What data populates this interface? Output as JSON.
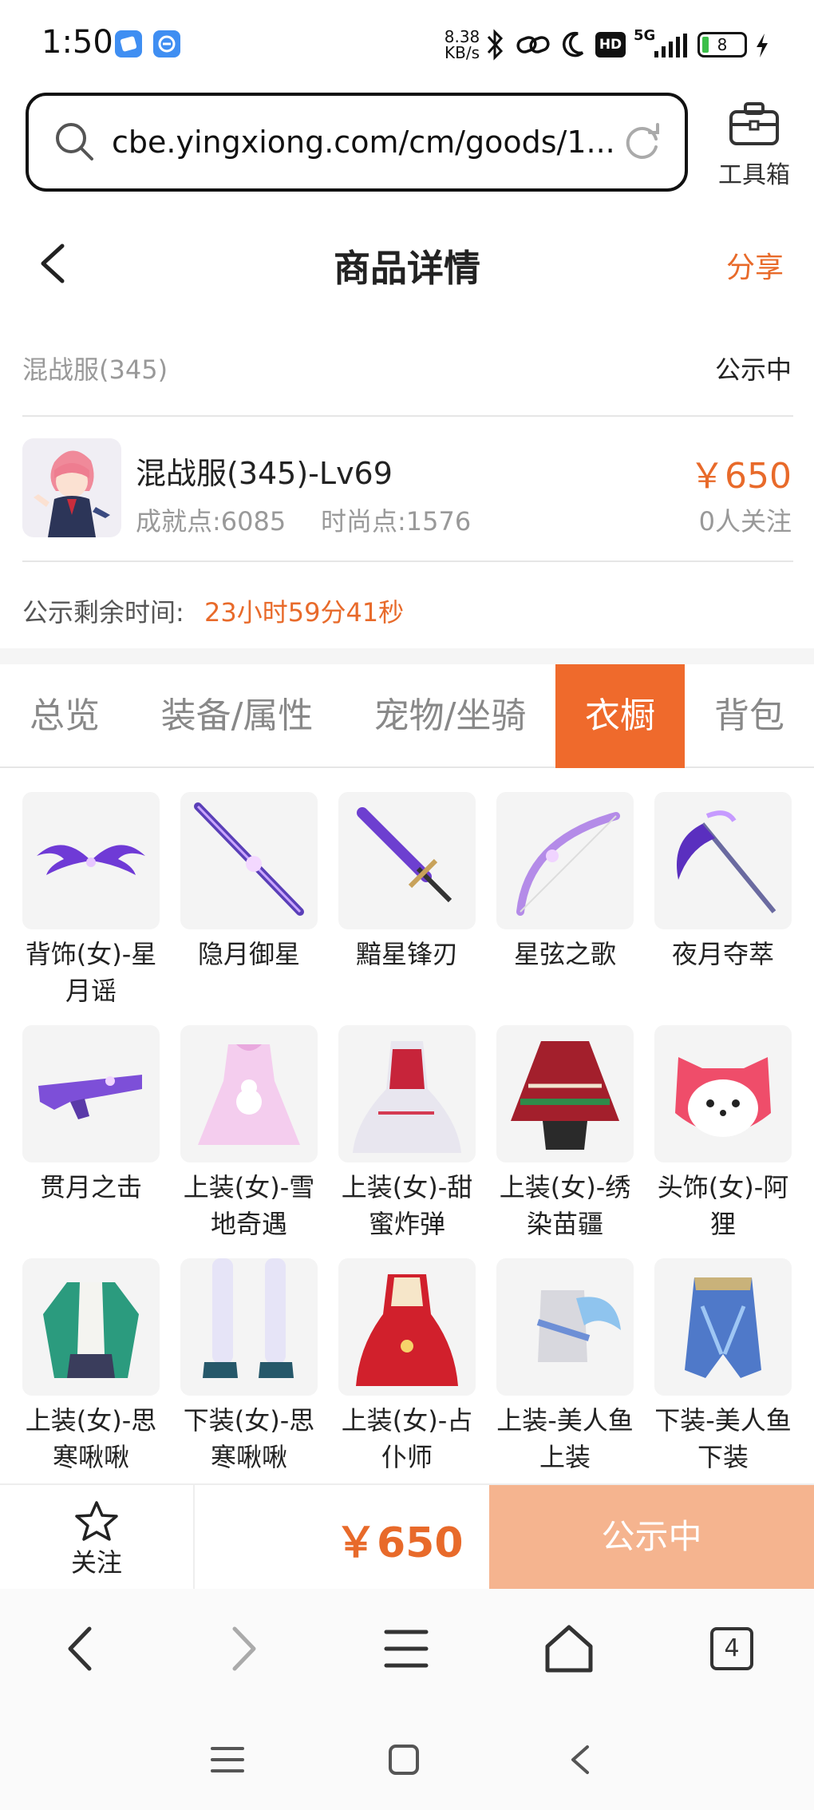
{
  "status_bar": {
    "time": "1:50",
    "net_speed_value": "8.38",
    "net_speed_unit": "KB/s",
    "hd_badge": "HD",
    "network": "5G",
    "battery": "8"
  },
  "browser": {
    "url": "cbe.yingxiong.com/cm/goods/1...",
    "toolbox_label": "工具箱"
  },
  "header": {
    "title": "商品详情",
    "share_label": "分享"
  },
  "listing": {
    "server": "混战服(345)",
    "status": "公示中",
    "character_name": "混战服(345)-Lv69",
    "achievement": "成就点:6085",
    "fashion": "时尚点:1576",
    "price": "￥650",
    "followers": "0人关注",
    "countdown_label": "公示剩余时间:",
    "countdown_value": "23小时59分41秒"
  },
  "tabs": [
    {
      "label": "总览",
      "active": false
    },
    {
      "label": "装备/属性",
      "active": false
    },
    {
      "label": "宠物/坐骑",
      "active": false
    },
    {
      "label": "衣橱",
      "active": true
    },
    {
      "label": "背包",
      "active": false
    }
  ],
  "wardrobe": [
    {
      "name": "背饰(女)-星月谣",
      "icon": "wings-icon"
    },
    {
      "name": "隐月御星",
      "icon": "staff-icon"
    },
    {
      "name": "黯星锋刃",
      "icon": "sword-icon"
    },
    {
      "name": "星弦之歌",
      "icon": "bow-icon"
    },
    {
      "name": "夜月夺萃",
      "icon": "scythe-icon"
    },
    {
      "name": "贯月之击",
      "icon": "gun-icon"
    },
    {
      "name": "上装(女)-雪地奇遇",
      "icon": "dress-icon"
    },
    {
      "name": "上装(女)-甜蜜炸弹",
      "icon": "gown-icon"
    },
    {
      "name": "上装(女)-绣染苗疆",
      "icon": "poncho-icon"
    },
    {
      "name": "头饰(女)-阿狸",
      "icon": "fox-head-icon"
    },
    {
      "name": "上装(女)-思寒啾啾",
      "icon": "jacket-icon"
    },
    {
      "name": "下装(女)-思寒啾啾",
      "icon": "legs-icon"
    },
    {
      "name": "上装(女)-占仆师",
      "icon": "red-dress-icon"
    },
    {
      "name": "上装-美人鱼上装",
      "icon": "mermaid-top-icon"
    },
    {
      "name": "下装-美人鱼下装",
      "icon": "mermaid-bottom-icon"
    }
  ],
  "action_bar": {
    "follow_label": "关注",
    "price": "￥650",
    "cta_label": "公示中"
  },
  "browser_nav": {
    "tab_count": "4"
  },
  "colors": {
    "accent": "#e86a2a",
    "tab_active_bg": "#ef6a2c",
    "cta_bg": "#f5b48f"
  }
}
